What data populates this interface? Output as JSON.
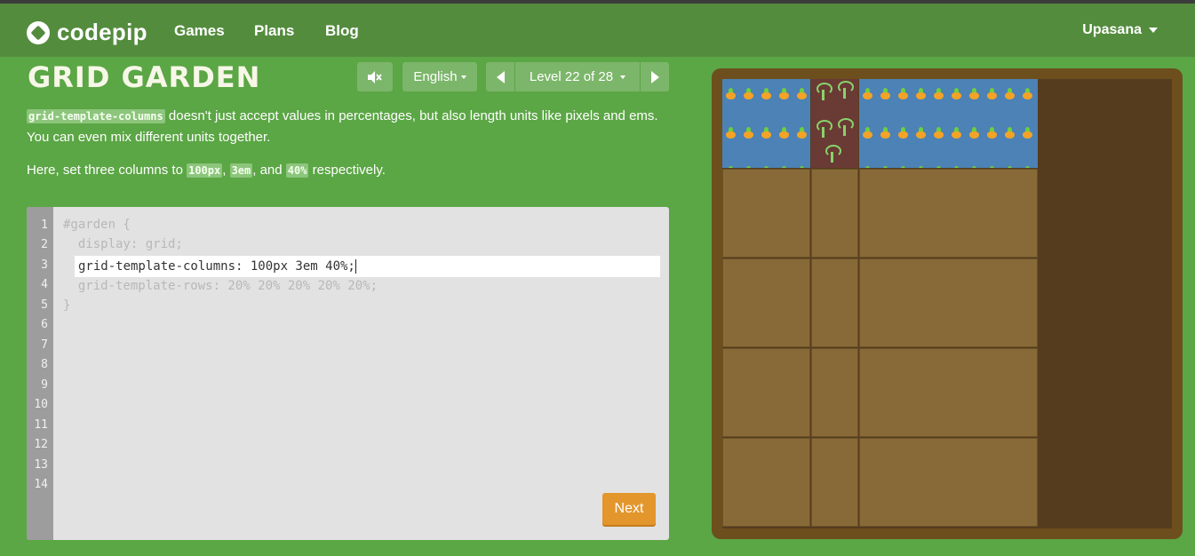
{
  "navbar": {
    "logo_text": "codepip",
    "links": [
      "Games",
      "Plans",
      "Blog"
    ],
    "user": "Upasana"
  },
  "game": {
    "title": "GRID GARDEN",
    "language": "English",
    "level_label": "Level 22 of 28",
    "mute_icon": "speaker-mute-icon"
  },
  "instructions": {
    "p1_code": "grid-template-columns",
    "p1_text": " doesn't just accept values in percentages, but also length units like pixels and ems.",
    "p1_text2": "You can even mix different units together.",
    "p2_before": "Here, set three columns to ",
    "p2_code1": "100px",
    "p2_sep1": ", ",
    "p2_code2": "3em",
    "p2_sep2": ", and ",
    "p2_code3": "40%",
    "p2_after": " respectively."
  },
  "editor": {
    "line_numbers": [
      "1",
      "2",
      "3",
      "4",
      "5",
      "6",
      "7",
      "8",
      "9",
      "10",
      "11",
      "12",
      "13",
      "14"
    ],
    "line1": "#garden {",
    "line2": "  display: grid;",
    "input_value": "grid-template-columns: 100px 3em 40%;",
    "line4": "  grid-template-rows: 20% 20% 20% 20% 20%;",
    "line5": "}",
    "next_label": "Next"
  },
  "colors": {
    "background": "#5ba645",
    "navbar": "#548c3e",
    "next_button": "#e3962b",
    "garden_frame": "#6d4f1e",
    "soil": "#886a38",
    "water": "#4c82b5",
    "poison": "#6a3a35"
  }
}
